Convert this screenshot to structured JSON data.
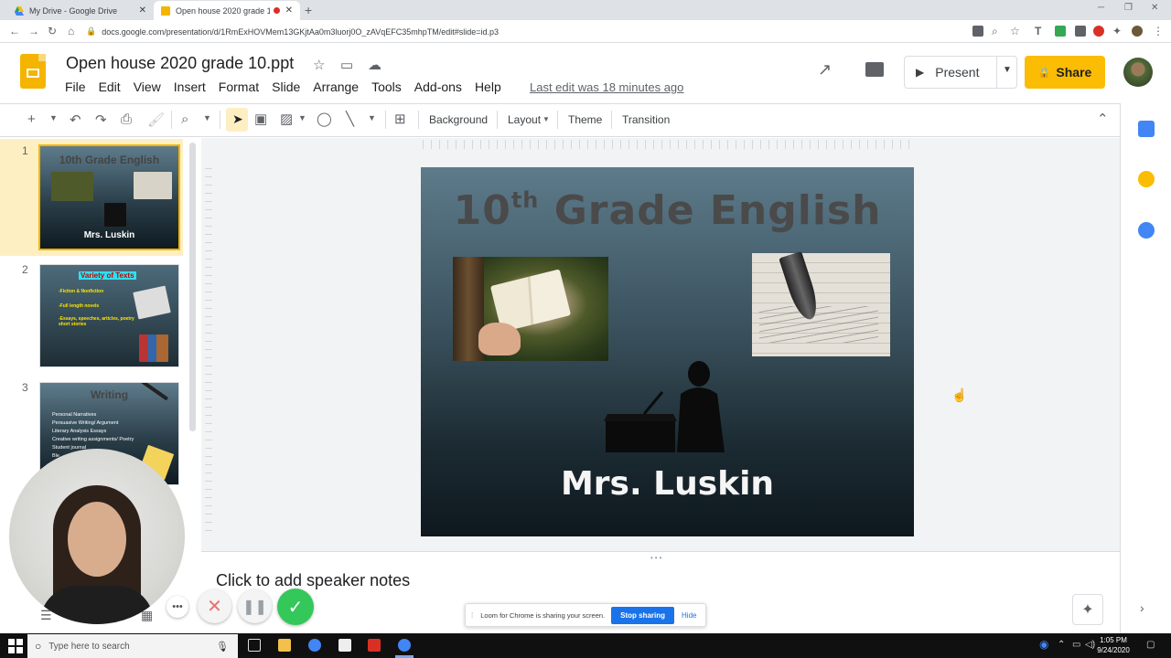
{
  "browser": {
    "tabs": [
      {
        "title": "My Drive - Google Drive",
        "active": false
      },
      {
        "title": "Open house 2020 grade 10.pptx",
        "active": true,
        "recording": true
      }
    ],
    "url": "docs.google.com/presentation/d/1RmExHOVMem13GKjtAa0m3luorj0O_zAVqEFC35mhpTM/edit#slide=id.p3"
  },
  "document": {
    "title": "Open house 2020 grade 10.ppt",
    "menus": [
      "File",
      "Edit",
      "View",
      "Insert",
      "Format",
      "Slide",
      "Arrange",
      "Tools",
      "Add-ons",
      "Help"
    ],
    "last_edit": "Last edit was 18 minutes ago",
    "present_label": "Present",
    "share_label": "Share"
  },
  "toolbar": {
    "background_label": "Background",
    "layout_label": "Layout",
    "theme_label": "Theme",
    "transition_label": "Transition"
  },
  "filmstrip": {
    "slides": [
      {
        "number": "1",
        "title": "10th Grade English",
        "subtitle": "Mrs. Luskin"
      },
      {
        "number": "2",
        "title": "Variety of Texts",
        "lines": [
          "-Fiction & Nonfiction",
          "-Full length novels",
          "-Essays, speeches, articles, poetry",
          "short stories"
        ]
      },
      {
        "number": "3",
        "title": "Writing",
        "bullets": [
          "Personal Narratives",
          "Persuasive Writing/ Argument",
          "Literary Analysis Essays",
          "Creative writing assignments/ Poetry",
          "Student journal",
          "Ble"
        ]
      }
    ]
  },
  "slide": {
    "title_main": "10",
    "title_sup": "th",
    "title_rest": " Grade English",
    "subtitle": "Mrs. Luskin"
  },
  "notes": {
    "placeholder": "Click to add speaker notes"
  },
  "loom": {
    "banner_text": "Loom for Chrome is sharing your screen.",
    "stop_label": "Stop sharing",
    "hide_label": "Hide"
  },
  "taskbar": {
    "search_placeholder": "Type here to search",
    "time": "1:05 PM",
    "date": "9/24/2020"
  },
  "colors": {
    "accent_yellow": "#fbbc04",
    "loom_green": "#34c759",
    "stop_blue": "#1a73e8"
  }
}
